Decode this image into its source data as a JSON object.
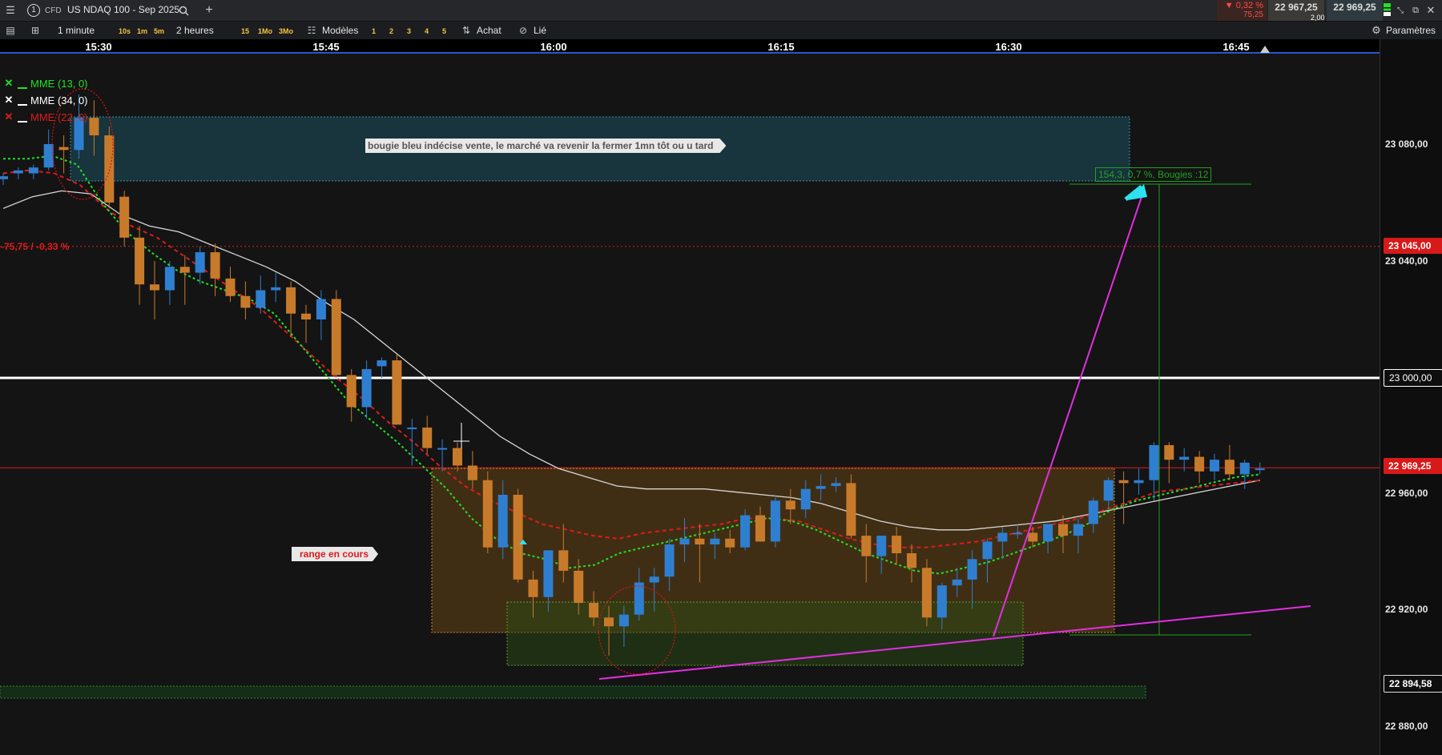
{
  "titlebar": {
    "menu_icon": "menu-icon",
    "instrument_count": "1",
    "instrument_type": "CFD",
    "instrument_name": "US NDAQ 100 - Sep 2025",
    "change_pct": "▼ 0,32 %",
    "change_pts": "75,25",
    "bid": "22 967,25",
    "spread": "2,00",
    "ask": "22 969,25"
  },
  "toolbar": {
    "timeframe": "1 minute",
    "quick_timeframes": [
      "10s",
      "1m",
      "5m"
    ],
    "duration": "2 heures",
    "quick_durations": [
      "15",
      "1Mo",
      "3Mo"
    ],
    "templates_label": "Modèles",
    "template_slots": [
      "1",
      "2",
      "3",
      "4",
      "5"
    ],
    "buy_label": "Achat",
    "link_label": "Lié",
    "settings_label": "Paramètres"
  },
  "time_axis": [
    "15:30",
    "15:45",
    "16:00",
    "16:15",
    "16:30",
    "16:45"
  ],
  "price_axis": {
    "ticks": [
      "23 080,00",
      "23 040,00",
      "22 960,00",
      "22 920,00",
      "22 880,00"
    ],
    "boxes": {
      "alert_red": "23 045,00",
      "level_white": "23 000,00",
      "current": "22 969,25",
      "level_low": "22 894,58"
    }
  },
  "legend": [
    {
      "label": "MME (13, 0)",
      "color": "#22e022"
    },
    {
      "label": "MME (34, 0)",
      "color": "#ffffff"
    },
    {
      "label": "MME (22, 0)",
      "color": "#e01b1b"
    }
  ],
  "annotations": {
    "note": "bougie bleu indécise vente, le marché va revenir la fermer 1mn tôt ou u tard",
    "range": "range en cours",
    "measure": "154,3, 0,7 %, Bougies :12",
    "prev_close_diff": "-75,75 / -0,33 %"
  },
  "colors": {
    "bull": "#2f7fd1",
    "bear": "#c87a2b",
    "ema_fast": "#22e022",
    "ema_mid": "#e01b1b",
    "ema_slow": "#d8d8d8",
    "magenta": "#e12fe1",
    "current_price": "#e01b1b"
  },
  "chart_data": {
    "type": "candlestick",
    "interval": "1 minute",
    "candles": [
      {
        "o": 23068,
        "h": 23070,
        "l": 23066,
        "c": 23069
      },
      {
        "o": 23070,
        "h": 23072,
        "l": 23068,
        "c": 23071
      },
      {
        "o": 23070,
        "h": 23073,
        "l": 23068,
        "c": 23072
      },
      {
        "o": 23072,
        "h": 23085,
        "l": 23071,
        "c": 23080
      },
      {
        "o": 23079,
        "h": 23083,
        "l": 23070,
        "c": 23078
      },
      {
        "o": 23078,
        "h": 23097,
        "l": 23075,
        "c": 23089
      },
      {
        "o": 23089,
        "h": 23095,
        "l": 23076,
        "c": 23083
      },
      {
        "o": 23083,
        "h": 23086,
        "l": 23058,
        "c": 23060
      },
      {
        "o": 23062,
        "h": 23064,
        "l": 23045,
        "c": 23048
      },
      {
        "o": 23048,
        "h": 23052,
        "l": 23025,
        "c": 23032
      },
      {
        "o": 23032,
        "h": 23040,
        "l": 23020,
        "c": 23030
      },
      {
        "o": 23030,
        "h": 23040,
        "l": 23025,
        "c": 23038
      },
      {
        "o": 23038,
        "h": 23042,
        "l": 23025,
        "c": 23036
      },
      {
        "o": 23036,
        "h": 23045,
        "l": 23032,
        "c": 23043
      },
      {
        "o": 23043,
        "h": 23046,
        "l": 23028,
        "c": 23034
      },
      {
        "o": 23034,
        "h": 23038,
        "l": 23026,
        "c": 23028
      },
      {
        "o": 23028,
        "h": 23033,
        "l": 23020,
        "c": 23024
      },
      {
        "o": 23024,
        "h": 23035,
        "l": 23022,
        "c": 23030
      },
      {
        "o": 23030,
        "h": 23036,
        "l": 23026,
        "c": 23031
      },
      {
        "o": 23031,
        "h": 23033,
        "l": 23014,
        "c": 23022
      },
      {
        "o": 23022,
        "h": 23025,
        "l": 23012,
        "c": 23020
      },
      {
        "o": 23020,
        "h": 23030,
        "l": 23013,
        "c": 23027
      },
      {
        "o": 23027,
        "h": 23030,
        "l": 23000,
        "c": 23001
      },
      {
        "o": 23001,
        "h": 23003,
        "l": 22985,
        "c": 22990
      },
      {
        "o": 22990,
        "h": 23006,
        "l": 22986,
        "c": 23003
      },
      {
        "o": 23004,
        "h": 23007,
        "l": 23000,
        "c": 23006
      },
      {
        "o": 23006,
        "h": 23008,
        "l": 22985,
        "c": 22984
      },
      {
        "o": 22983,
        "h": 22986,
        "l": 22970,
        "c": 22983
      },
      {
        "o": 22983,
        "h": 22987,
        "l": 22974,
        "c": 22976
      },
      {
        "o": 22976,
        "h": 22979,
        "l": 22968,
        "c": 22976
      },
      {
        "o": 22976,
        "h": 22978,
        "l": 22968,
        "c": 22970
      },
      {
        "o": 22970,
        "h": 22975,
        "l": 22962,
        "c": 22965
      },
      {
        "o": 22965,
        "h": 22968,
        "l": 22940,
        "c": 22942
      },
      {
        "o": 22942,
        "h": 22965,
        "l": 22938,
        "c": 22960
      },
      {
        "o": 22960,
        "h": 22962,
        "l": 22930,
        "c": 22931
      },
      {
        "o": 22931,
        "h": 22934,
        "l": 22918,
        "c": 22925
      },
      {
        "o": 22925,
        "h": 22935,
        "l": 22920,
        "c": 22941
      },
      {
        "o": 22941,
        "h": 22950,
        "l": 22930,
        "c": 22934
      },
      {
        "o": 22934,
        "h": 22938,
        "l": 22919,
        "c": 22923
      },
      {
        "o": 22923,
        "h": 22927,
        "l": 22915,
        "c": 22918
      },
      {
        "o": 22918,
        "h": 22922,
        "l": 22905,
        "c": 22915
      },
      {
        "o": 22915,
        "h": 22922,
        "l": 22908,
        "c": 22919
      },
      {
        "o": 22919,
        "h": 22935,
        "l": 22917,
        "c": 22930
      },
      {
        "o": 22930,
        "h": 22935,
        "l": 22920,
        "c": 22932
      },
      {
        "o": 22932,
        "h": 22945,
        "l": 22927,
        "c": 22943
      },
      {
        "o": 22943,
        "h": 22952,
        "l": 22937,
        "c": 22945
      },
      {
        "o": 22945,
        "h": 22950,
        "l": 22930,
        "c": 22943
      },
      {
        "o": 22943,
        "h": 22947,
        "l": 22938,
        "c": 22945
      },
      {
        "o": 22945,
        "h": 22948,
        "l": 22940,
        "c": 22942
      },
      {
        "o": 22942,
        "h": 22955,
        "l": 22941,
        "c": 22953
      },
      {
        "o": 22953,
        "h": 22956,
        "l": 22944,
        "c": 22944
      },
      {
        "o": 22944,
        "h": 22960,
        "l": 22942,
        "c": 22958
      },
      {
        "o": 22958,
        "h": 22962,
        "l": 22950,
        "c": 22955
      },
      {
        "o": 22955,
        "h": 22965,
        "l": 22952,
        "c": 22962
      },
      {
        "o": 22962,
        "h": 22967,
        "l": 22958,
        "c": 22963
      },
      {
        "o": 22963,
        "h": 22966,
        "l": 22961,
        "c": 22964
      },
      {
        "o": 22964,
        "h": 22967,
        "l": 22945,
        "c": 22946
      },
      {
        "o": 22946,
        "h": 22950,
        "l": 22930,
        "c": 22939
      },
      {
        "o": 22939,
        "h": 22946,
        "l": 22933,
        "c": 22946
      },
      {
        "o": 22946,
        "h": 22949,
        "l": 22936,
        "c": 22940
      },
      {
        "o": 22940,
        "h": 22943,
        "l": 22930,
        "c": 22935
      },
      {
        "o": 22935,
        "h": 22938,
        "l": 22915,
        "c": 22918
      },
      {
        "o": 22918,
        "h": 22930,
        "l": 22914,
        "c": 22929
      },
      {
        "o": 22929,
        "h": 22935,
        "l": 22925,
        "c": 22931
      },
      {
        "o": 22931,
        "h": 22941,
        "l": 22921,
        "c": 22938
      },
      {
        "o": 22938,
        "h": 22945,
        "l": 22930,
        "c": 22944
      },
      {
        "o": 22944,
        "h": 22949,
        "l": 22938,
        "c": 22947
      },
      {
        "o": 22947,
        "h": 22950,
        "l": 22945,
        "c": 22947
      },
      {
        "o": 22947,
        "h": 22949,
        "l": 22942,
        "c": 22944
      },
      {
        "o": 22944,
        "h": 22950,
        "l": 22940,
        "c": 22950
      },
      {
        "o": 22950,
        "h": 22953,
        "l": 22940,
        "c": 22946
      },
      {
        "o": 22946,
        "h": 22952,
        "l": 22940,
        "c": 22950
      },
      {
        "o": 22950,
        "h": 22959,
        "l": 22947,
        "c": 22958
      },
      {
        "o": 22958,
        "h": 22966,
        "l": 22955,
        "c": 22965
      },
      {
        "o": 22965,
        "h": 22968,
        "l": 22950,
        "c": 22964
      },
      {
        "o": 22964,
        "h": 22969,
        "l": 22960,
        "c": 22965
      },
      {
        "o": 22965,
        "h": 22978,
        "l": 22958,
        "c": 22977
      },
      {
        "o": 22977,
        "h": 22978,
        "l": 22964,
        "c": 22972
      },
      {
        "o": 22972,
        "h": 22976,
        "l": 22968,
        "c": 22973
      },
      {
        "o": 22973,
        "h": 22975,
        "l": 22964,
        "c": 22968
      },
      {
        "o": 22968,
        "h": 22974,
        "l": 22965,
        "c": 22972
      },
      {
        "o": 22972,
        "h": 22977,
        "l": 22965,
        "c": 22967
      },
      {
        "o": 22967,
        "h": 22972,
        "l": 22962,
        "c": 22971
      },
      {
        "o": 22969,
        "h": 22971,
        "l": 22967,
        "c": 22969
      }
    ],
    "ema_13": [
      23075,
      23075,
      23076,
      23073,
      23060,
      23050,
      23043,
      23037,
      23033,
      23030,
      23027,
      23022,
      23012,
      23002,
      22992,
      22985,
      22978,
      22970,
      22962,
      22952,
      22945,
      22940,
      22938,
      22935,
      22936,
      22940,
      22942,
      22944,
      22946,
      22948,
      22950,
      22952,
      22951,
      22948,
      22944,
      22940,
      22937,
      22934,
      22933,
      22935,
      22937,
      22940,
      22943,
      22946,
      22950,
      22955,
      22958,
      22960,
      22962,
      22964,
      22966,
      22967
    ],
    "ema_22": [
      23070,
      23071,
      23070,
      23066,
      23058,
      23052,
      23048,
      23042,
      23036,
      23030,
      23024,
      23016,
      23008,
      23000,
      22993,
      22985,
      22978,
      22970,
      22963,
      22958,
      22954,
      22950,
      22948,
      22946,
      22945,
      22947,
      22948,
      22949,
      22950,
      22952,
      22952,
      22951,
      22948,
      22945,
      22943,
      22942,
      22942,
      22943,
      22944,
      22946,
      22948,
      22950,
      22952,
      22955,
      22958,
      22961,
      22962,
      22963,
      22964,
      22965
    ],
    "ema_34": [
      23058,
      23062,
      23064,
      23063,
      23056,
      23052,
      23050,
      23046,
      23042,
      23038,
      23033,
      23026,
      23020,
      23012,
      23004,
      22996,
      22988,
      22980,
      22974,
      22969,
      22966,
      22963,
      22962,
      22962,
      22962,
      22961,
      22960,
      22959,
      22957,
      22954,
      22951,
      22949,
      22948,
      22948,
      22949,
      22950,
      22951,
      22953,
      22955,
      22957,
      22959,
      22961,
      22963,
      22965
    ],
    "levels": {
      "alert_line": 23045.0,
      "round_level": 23000.0,
      "current_price": 22969.25,
      "low_level": 22894.58
    },
    "measure": {
      "points": 154.3,
      "percent": 0.7,
      "candles": 12
    }
  }
}
